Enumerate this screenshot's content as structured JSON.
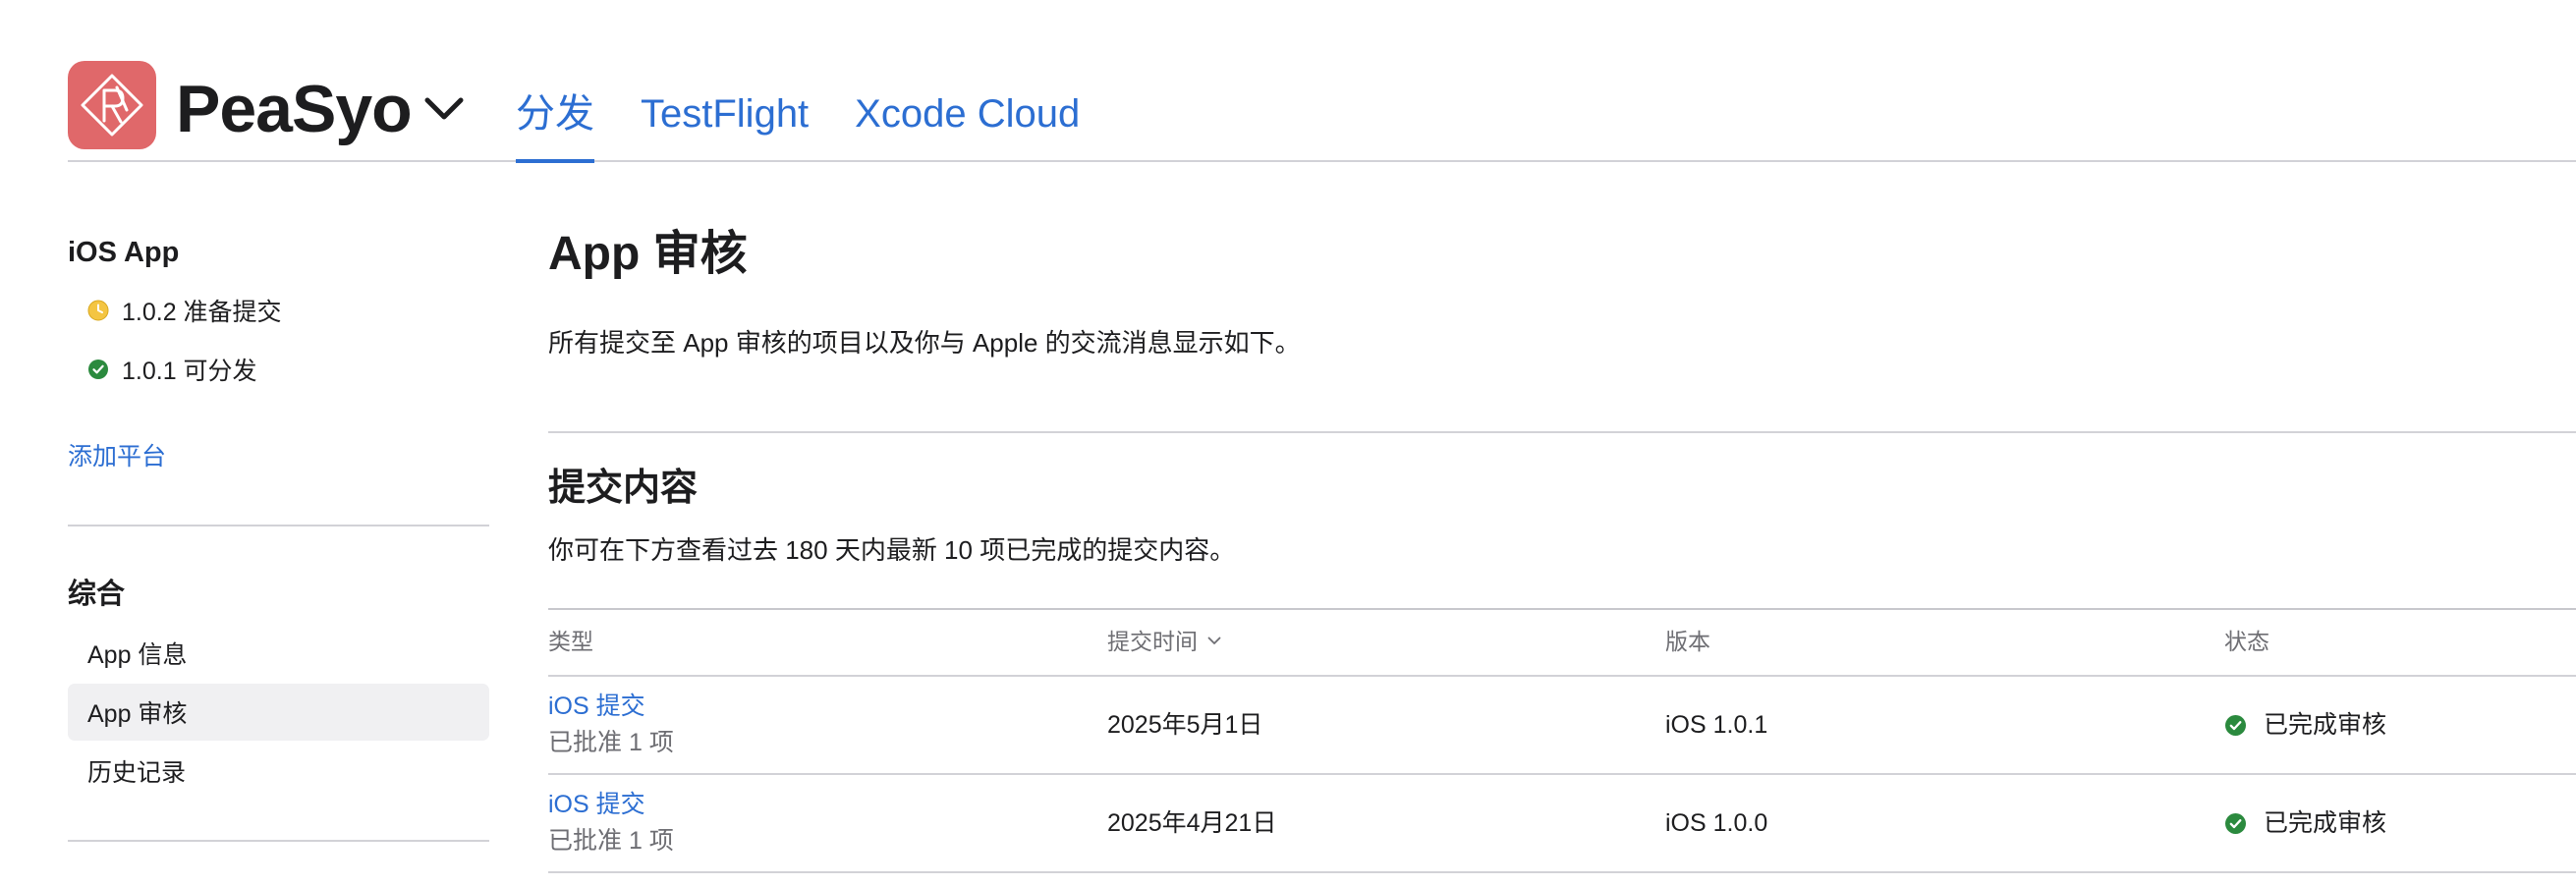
{
  "colors": {
    "accent": "#2c6ed2",
    "text": "#1d1d1f",
    "secondary": "#6e6e73",
    "divider": "#d2d2d7",
    "table_top": "#c7c7cc",
    "selected_bg": "#f0f0f2",
    "icon_bg": "#e0686a",
    "status_ready": "#2b8a3e",
    "status_preparing": "#f4c542"
  },
  "header": {
    "app_icon": "app-logo-icon",
    "app_name": "PeaSyo",
    "app_switch_icon": "chevron-down-icon",
    "tabs": [
      {
        "label": "分发",
        "active": true
      },
      {
        "label": "TestFlight",
        "active": false
      },
      {
        "label": "Xcode Cloud",
        "active": false
      }
    ]
  },
  "sidebar": {
    "platform_title": "iOS App",
    "versions": [
      {
        "label": "1.0.2 准备提交",
        "icon": "clock-icon"
      },
      {
        "label": "1.0.1 可分发",
        "icon": "check-circle-icon"
      }
    ],
    "add_platform": "添加平台",
    "general_title": "综合",
    "general_items": [
      {
        "label": "App 信息",
        "selected": false
      },
      {
        "label": "App 审核",
        "selected": true
      },
      {
        "label": "历史记录",
        "selected": false
      }
    ]
  },
  "main": {
    "title": "App 审核",
    "description": "所有提交至 App 审核的项目以及你与 Apple 的交流消息显示如下。",
    "submissions": {
      "title": "提交内容",
      "description": "你可在下方查看过去 180 天内最新 10 项已完成的提交内容。",
      "columns": [
        {
          "label": "类型"
        },
        {
          "label": "提交时间",
          "sort_icon": "chevron-down-icon"
        },
        {
          "label": "版本"
        },
        {
          "label": "状态"
        }
      ],
      "rows": [
        {
          "type": "iOS 提交",
          "detail": "已批准 1 项",
          "date": "2025年5月1日",
          "version": "iOS 1.0.1",
          "status": "已完成审核",
          "status_icon": "check-circle-icon"
        },
        {
          "type": "iOS 提交",
          "detail": "已批准 1 项",
          "date": "2025年4月21日",
          "version": "iOS 1.0.0",
          "status": "已完成审核",
          "status_icon": "check-circle-icon"
        }
      ]
    }
  }
}
